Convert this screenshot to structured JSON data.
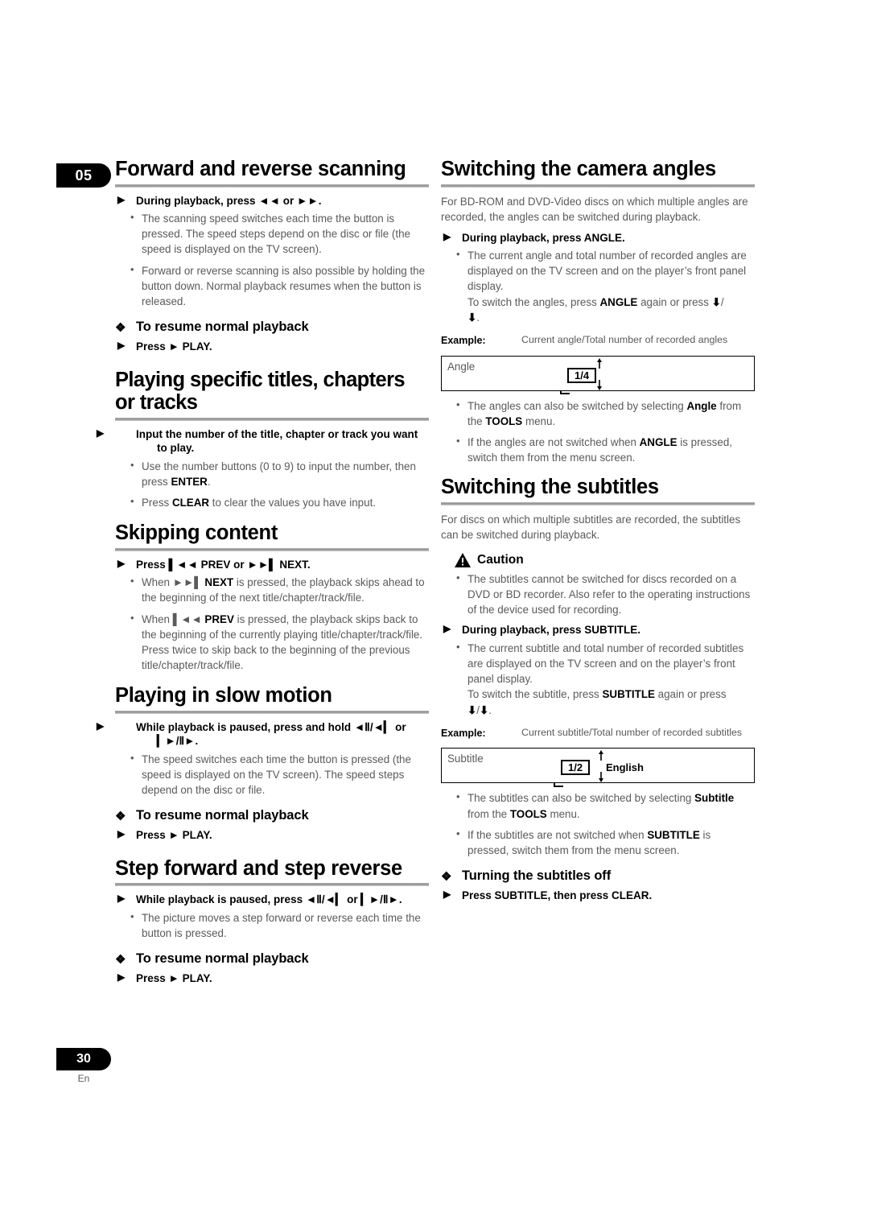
{
  "chapter_badge": "05",
  "footer": {
    "page_number": "30",
    "language": "En"
  },
  "left_column": {
    "sections": [
      {
        "title": "Forward and reverse scanning",
        "step": "During playback, press ◄◄ or ►►.",
        "bullets": [
          "The scanning speed switches each time the button is pressed. The speed steps depend on the disc or file (the speed is displayed on the TV screen).",
          "Forward or reverse scanning is also possible by holding the button down. Normal playback resumes when the button is released."
        ],
        "sub_head": "To resume normal playback",
        "sub_step": "Press ► PLAY."
      },
      {
        "title": "Playing specific titles, chapters or tracks",
        "step": "Input the number of the title, chapter or track you want to play.",
        "bullets": [
          "Use the number buttons (0 to 9) to input the number, then press ENTER.",
          "Press CLEAR to clear the values you have input."
        ]
      },
      {
        "title": "Skipping content",
        "step": "Press ▎◄◄ PREV or ►►▎ NEXT.",
        "bullets": [
          "When ►►▎ NEXT is pressed, the playback skips ahead to the beginning of the next title/chapter/track/file.",
          "When ▎◄◄ PREV is pressed, the playback skips back to the beginning of the currently playing title/chapter/track/file. Press twice to skip back to the beginning of the previous title/chapter/track/file."
        ]
      },
      {
        "title": "Playing in slow motion",
        "step": "While playback is paused, press and hold ◄Ⅱ/◄▎ or ▎►/Ⅱ►.",
        "bullets": [
          "The speed switches each time the button is pressed (the speed is displayed on the TV screen). The speed steps depend on the disc or file."
        ],
        "sub_head": "To resume normal playback",
        "sub_step": "Press ► PLAY."
      },
      {
        "title": "Step forward and step reverse",
        "step": "While playback is paused, press ◄Ⅱ/◄▎ or ▎►/Ⅱ►.",
        "bullets": [
          "The picture moves a step forward or reverse each time the button is pressed."
        ],
        "sub_head": "To resume normal playback",
        "sub_step": "Press ► PLAY."
      }
    ]
  },
  "right_column": {
    "angle_section": {
      "title": "Switching the camera angles",
      "intro": "For BD-ROM and DVD-Video discs on which multiple angles are recorded, the angles can be switched during playback.",
      "step": "During playback, press ANGLE.",
      "bullet_main_1": "The current angle and total number of recorded angles are displayed on the TV screen and on the player’s front panel display.",
      "bullet_main_2": "To switch the angles, press ANGLE again or press ↑/↓.",
      "example_label": "Example:",
      "example_caption": "Current angle/Total number of recorded angles",
      "box_label": "Angle",
      "chip_value": "1/4",
      "bullets_after": [
        "The angles can also be switched by selecting Angle from the TOOLS menu.",
        "If the angles are not switched when ANGLE is pressed, switch them from the menu screen."
      ]
    },
    "subtitle_section": {
      "title": "Switching the subtitles",
      "intro": "For discs on which multiple subtitles are recorded, the subtitles can be switched during playback.",
      "caution_label": "Caution",
      "caution_bullet": "The subtitles cannot be switched for discs recorded on a DVD or BD recorder. Also refer to the operating instructions of the device used for recording.",
      "step": "During playback, press SUBTITLE.",
      "bullet_main_1": "The current subtitle and total number of recorded subtitles are displayed on the TV screen and on the player’s front panel display.",
      "bullet_main_2": "To switch the subtitle, press SUBTITLE again or press ↑/↓.",
      "example_label": "Example:",
      "example_caption": "Current subtitle/Total number of recorded subtitles",
      "box_label": "Subtitle",
      "chip_value": "1/2",
      "chip_text": "English",
      "bullets_after": [
        "The subtitles can also be switched by selecting Subtitle from the TOOLS menu.",
        "If the subtitles are not switched when SUBTITLE is pressed, switch them from the menu screen."
      ],
      "sub_head": "Turning the subtitles off",
      "sub_step": "Press SUBTITLE, then press CLEAR."
    }
  }
}
